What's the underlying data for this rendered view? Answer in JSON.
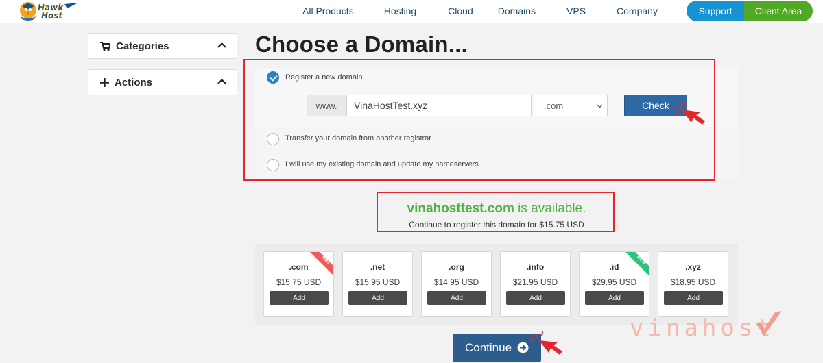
{
  "brand": {
    "logo_line1": "Hawk",
    "logo_line2": "Host"
  },
  "nav": {
    "items": [
      "All Products",
      "Hosting",
      "Cloud",
      "Domains",
      "VPS",
      "Company"
    ],
    "support_label": "Support",
    "client_area_label": "Client Area"
  },
  "sidebar": {
    "categories_label": "Categories",
    "actions_label": "Actions"
  },
  "page": {
    "title": "Choose a Domain..."
  },
  "domain_options": {
    "register_label": "Register a new domain",
    "register_checked": true,
    "www_prefix": "www.",
    "domain_value": "VinaHostTest.xyz",
    "tld_selected": ".com",
    "check_label": "Check",
    "transfer_label": "Transfer your domain from another registrar",
    "existing_label": "I will use my existing domain and update my nameservers"
  },
  "availability": {
    "domain": "vinahosttest.com",
    "status": " is available.",
    "subtext": "Continue to register this domain for $15.75 USD"
  },
  "tlds": [
    {
      "ext": ".com",
      "price": "$15.75 USD",
      "add": "Add",
      "badge": "HOT"
    },
    {
      "ext": ".net",
      "price": "$15.95 USD",
      "add": "Add",
      "badge": ""
    },
    {
      "ext": ".org",
      "price": "$14.95 USD",
      "add": "Add",
      "badge": ""
    },
    {
      "ext": ".info",
      "price": "$21.95 USD",
      "add": "Add",
      "badge": ""
    },
    {
      "ext": ".id",
      "price": "$29.95 USD",
      "add": "Add",
      "badge": "NEW"
    },
    {
      "ext": ".xyz",
      "price": "$18.95 USD",
      "add": "Add",
      "badge": ""
    }
  ],
  "continue_label": "Continue",
  "watermark": "vinahost",
  "colors": {
    "nav_text": "#1d4b6e",
    "support_bg": "#1792d3",
    "client_bg": "#51a925",
    "primary_button": "#2d6aa5",
    "available_green": "#52b045",
    "highlight_red": "#e3262c",
    "hot_badge": "#f25a5a",
    "new_badge": "#2ec27e"
  }
}
